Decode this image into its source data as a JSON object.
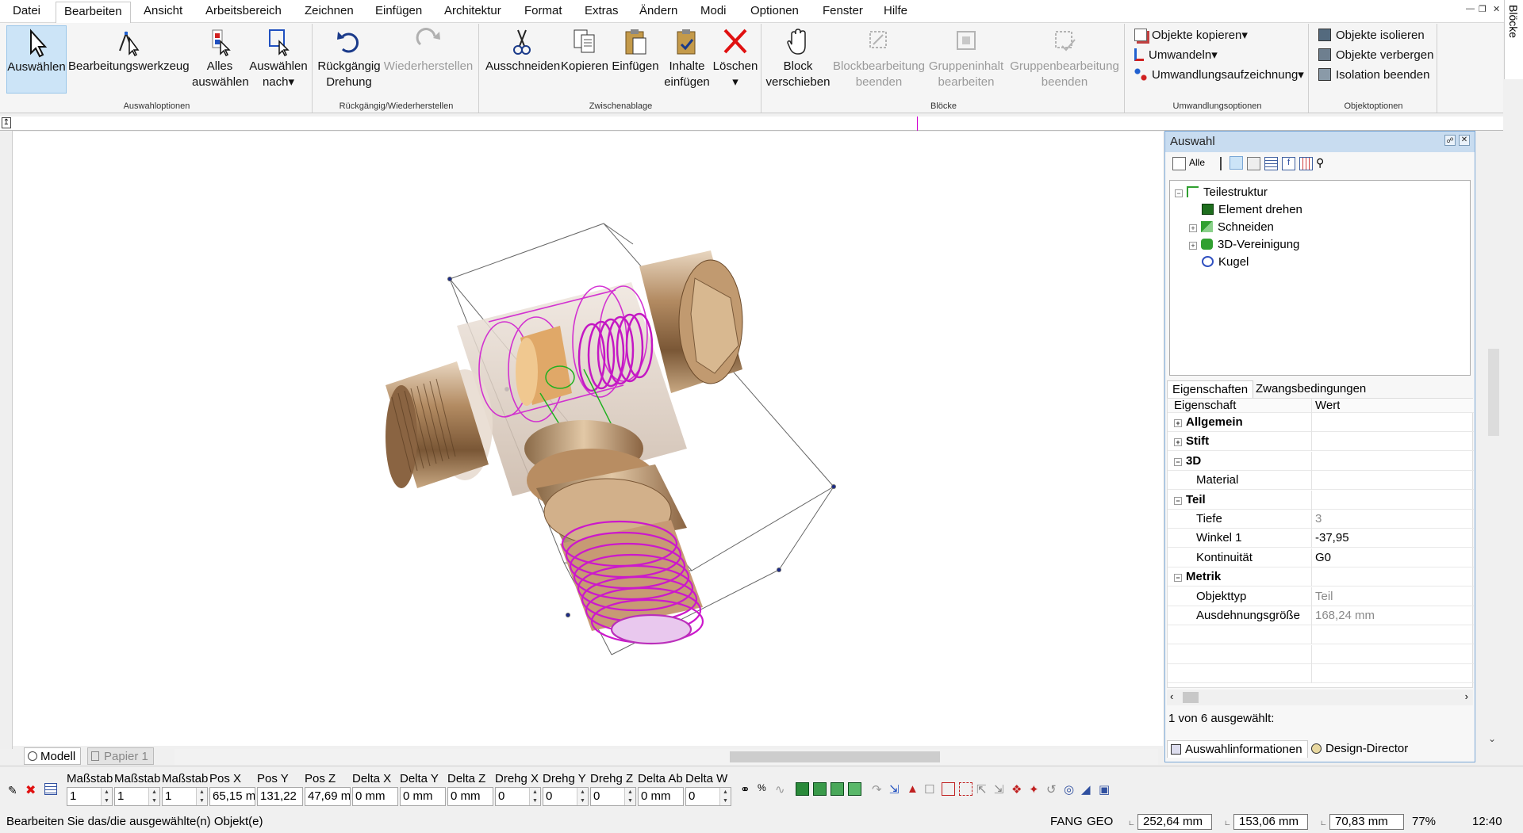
{
  "menu": [
    "Datei",
    "Bearbeiten",
    "Ansicht",
    "Arbeitsbereich",
    "Zeichnen",
    "Einfügen",
    "Architektur",
    "Format",
    "Extras",
    "Ändern",
    "Modi",
    "Optionen",
    "Fenster",
    "Hilfe"
  ],
  "ribbon": {
    "groups": {
      "selection": "Auswahloptionen",
      "undo": "Rückgängig/Wiederherstellen",
      "clipboard": "Zwischenablage",
      "blocks": "Blöcke",
      "transform": "Umwandlungsoptionen",
      "objects": "Objektoptionen"
    },
    "select": "Auswählen",
    "edit_tool": "Bearbeitungswerkzeug",
    "select_all": "Alles auswählen",
    "select_by": "Auswählen nach",
    "undo_rotation": "Rückgängig Drehung",
    "redo": "Wiederherstellen",
    "cut": "Ausschneiden",
    "copy": "Kopieren",
    "paste": "Einfügen",
    "paste_contents": "Inhalte einfügen",
    "delete": "Löschen",
    "move_block": "Block verschieben",
    "end_block_edit": "Blockbearbeitung beenden",
    "edit_group_content": "Gruppeninhalt bearbeiten",
    "end_group_edit": "Gruppenbearbeitung beenden",
    "copy_objects": "Objekte kopieren",
    "convert": "Umwandeln",
    "convert_recording": "Umwandlungsaufzeichnung",
    "isolate_objects": "Objekte isolieren",
    "hide_objects": "Objekte verbergen",
    "end_isolation": "Isolation beenden"
  },
  "side_tab": "Blöcke",
  "panel": {
    "title": "Auswahl",
    "tree": [
      {
        "label": "Teilestruktur",
        "level": 0
      },
      {
        "label": "Element drehen",
        "level": 1
      },
      {
        "label": "Schneiden",
        "level": 1
      },
      {
        "label": "3D-Vereinigung",
        "level": 1
      },
      {
        "label": "Kugel",
        "level": 1
      }
    ],
    "tabs": [
      "Eigenschaften",
      "Zwangsbedingungen"
    ],
    "col_property": "Eigenschaft",
    "col_value": "Wert",
    "properties": [
      {
        "name": "Allgemein",
        "value": "",
        "cat": true,
        "exp": "+"
      },
      {
        "name": "Stift",
        "value": "",
        "cat": true,
        "exp": "+"
      },
      {
        "name": "3D",
        "value": "",
        "cat": true,
        "exp": "−"
      },
      {
        "name": "Material",
        "value": "",
        "cat": false
      },
      {
        "name": "Teil",
        "value": "",
        "cat": true,
        "exp": "−"
      },
      {
        "name": "Tiefe",
        "value": "3",
        "cat": false,
        "gray": true
      },
      {
        "name": "Winkel 1",
        "value": "-37,95",
        "cat": false
      },
      {
        "name": "Kontinuität",
        "value": "G0",
        "cat": false
      },
      {
        "name": "Metrik",
        "value": "",
        "cat": true,
        "exp": "−"
      },
      {
        "name": "Objekttyp",
        "value": "Teil",
        "cat": false,
        "gray": true
      },
      {
        "name": "Ausdehnungsgröße",
        "value": "168,24 mm",
        "cat": false,
        "gray": true
      }
    ],
    "selection_info": "1 von 6 ausgewählt:",
    "bottom_tabs": [
      "Auswahlinformationen",
      "Design-Director"
    ]
  },
  "layout_tabs": [
    "Modell",
    "Papier 1"
  ],
  "inputs": [
    {
      "label": "Maßstab",
      "value": "1",
      "spin": true
    },
    {
      "label": "Maßstab",
      "value": "1",
      "spin": true
    },
    {
      "label": "Maßstab",
      "value": "1",
      "spin": true
    },
    {
      "label": "Pos X",
      "value": "65,15 mm",
      "spin": false
    },
    {
      "label": "Pos Y",
      "value": "131,22",
      "spin": false
    },
    {
      "label": "Pos Z",
      "value": "47,69 mm",
      "spin": false
    },
    {
      "label": "Delta X",
      "value": "0 mm",
      "spin": false
    },
    {
      "label": "Delta Y",
      "value": "0 mm",
      "spin": false
    },
    {
      "label": "Delta Z",
      "value": "0 mm",
      "spin": false
    },
    {
      "label": "Drehg X",
      "value": "0",
      "spin": true
    },
    {
      "label": "Drehg Y",
      "value": "0",
      "spin": true
    },
    {
      "label": "Drehg Z",
      "value": "0",
      "spin": true
    },
    {
      "label": "Delta Ab",
      "value": "0 mm",
      "spin": false
    },
    {
      "label": "Delta W",
      "value": "0",
      "spin": true
    }
  ],
  "status": {
    "message": "Bearbeiten Sie das/die ausgewählte(n) Objekt(e)",
    "fang": "FANG",
    "geo": "GEO",
    "x": "252,64 mm",
    "y": "153,06 mm",
    "z": "70,83 mm",
    "zoom": "77%",
    "time": "12:40"
  }
}
